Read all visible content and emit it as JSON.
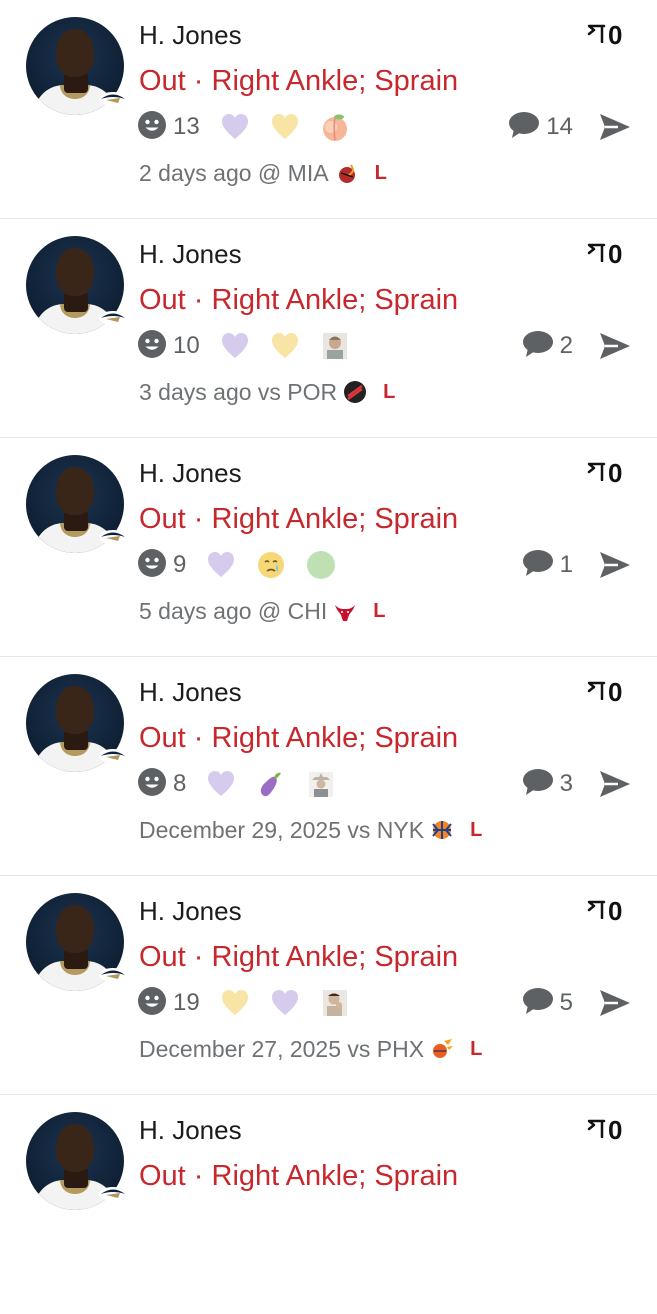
{
  "colors": {
    "status_red": "#c6282d",
    "purple_heart": "#d7cbed",
    "yellow_heart": "#f8e4a4",
    "gray_icon": "#5e6163"
  },
  "posts": [
    {
      "player": "H. Jones",
      "bookmarks": "0",
      "status": "Out · Right Ankle; Sprain",
      "reaction_count": "13",
      "emojis": [
        "purple-heart",
        "yellow-heart",
        "peach"
      ],
      "comment_count": "14",
      "time": "2 days ago",
      "matchup": "@ MIA",
      "opponent_logo": "heat-logo",
      "result": "L"
    },
    {
      "player": "H. Jones",
      "bookmarks": "0",
      "status": "Out · Right Ankle; Sprain",
      "reaction_count": "10",
      "emojis": [
        "purple-heart",
        "yellow-heart",
        "person-photo"
      ],
      "comment_count": "2",
      "time": "3 days ago",
      "matchup": "vs POR",
      "opponent_logo": "blazers-logo",
      "result": "L"
    },
    {
      "player": "H. Jones",
      "bookmarks": "0",
      "status": "Out · Right Ankle; Sprain",
      "reaction_count": "9",
      "emojis": [
        "purple-heart",
        "crying-face",
        "green-circle"
      ],
      "comment_count": "1",
      "time": "5 days ago",
      "matchup": "@ CHI",
      "opponent_logo": "bulls-logo",
      "result": "L"
    },
    {
      "player": "H. Jones",
      "bookmarks": "0",
      "status": "Out · Right Ankle; Sprain",
      "reaction_count": "8",
      "emojis": [
        "purple-heart",
        "eggplant",
        "cowboy-photo"
      ],
      "comment_count": "3",
      "time": "December 29, 2025",
      "matchup": "vs NYK",
      "opponent_logo": "knicks-logo",
      "result": "L"
    },
    {
      "player": "H. Jones",
      "bookmarks": "0",
      "status": "Out · Right Ankle; Sprain",
      "reaction_count": "19",
      "emojis": [
        "yellow-heart",
        "purple-heart",
        "thinking-person-photo"
      ],
      "comment_count": "5",
      "time": "December 27, 2025",
      "matchup": "vs PHX",
      "opponent_logo": "suns-logo",
      "result": "L"
    },
    {
      "player": "H. Jones",
      "bookmarks": "0",
      "status": "Out · Right Ankle; Sprain"
    }
  ]
}
